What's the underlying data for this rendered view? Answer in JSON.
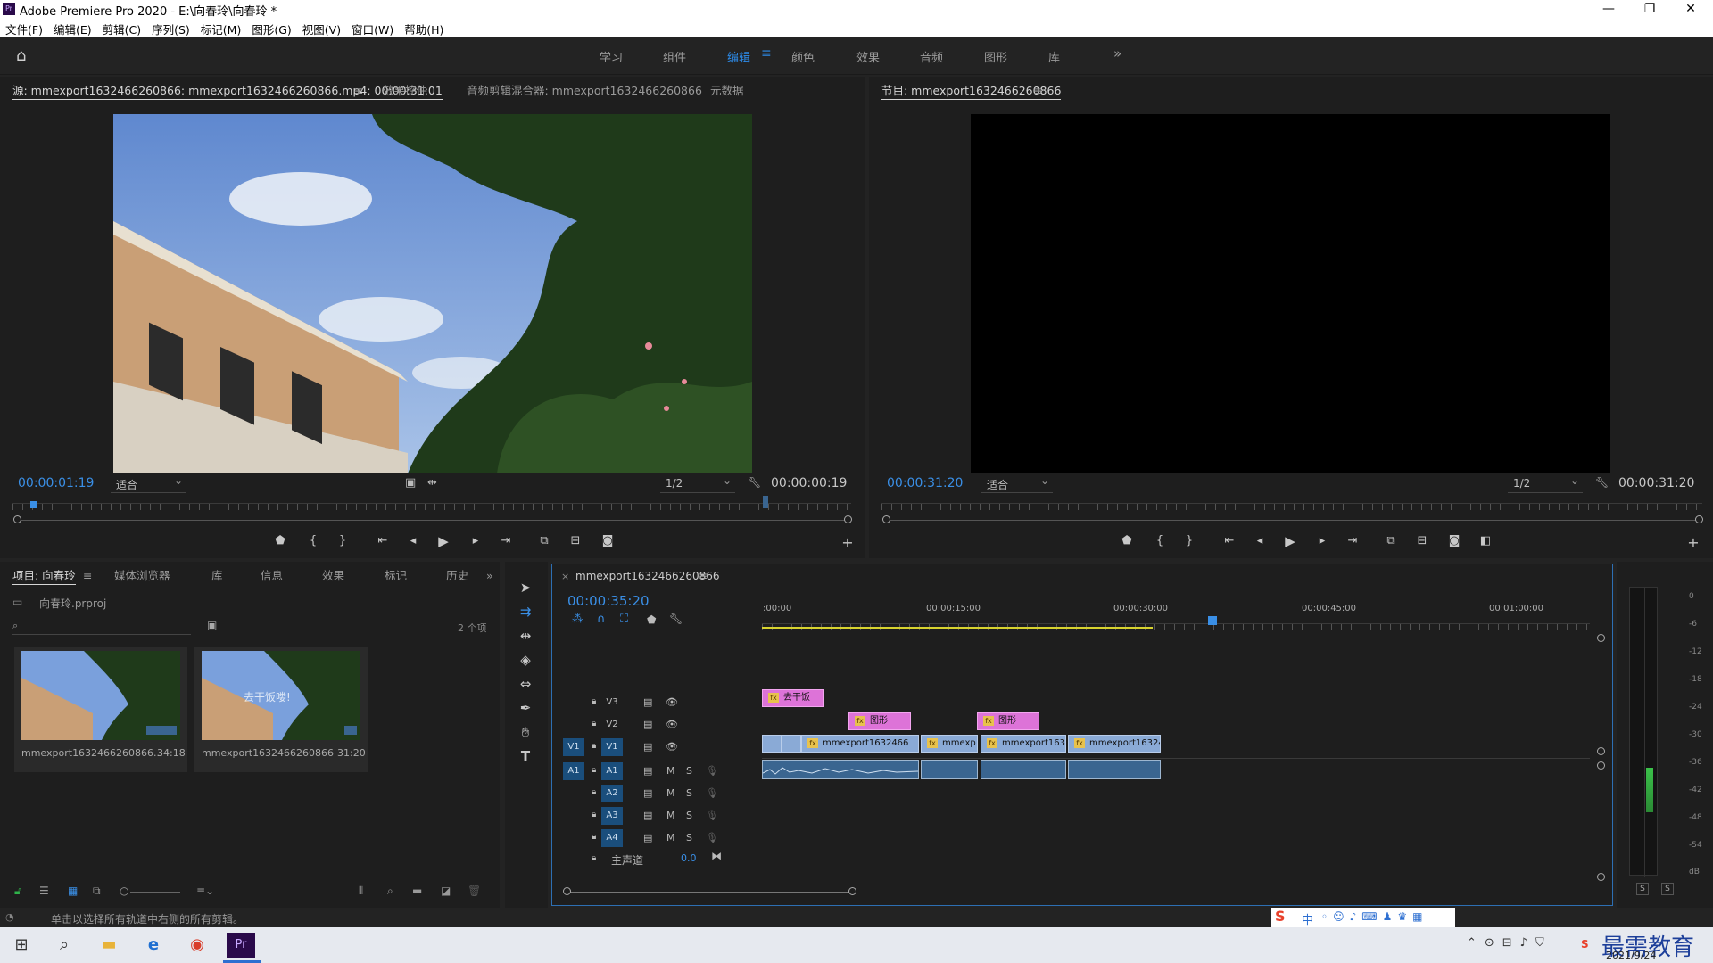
{
  "window": {
    "title": "Adobe Premiere Pro 2020 - E:\\向春玲\\向春玲 *",
    "app_icon_label": "Pr"
  },
  "menu": [
    "文件(F)",
    "编辑(E)",
    "剪辑(C)",
    "序列(S)",
    "标记(M)",
    "图形(G)",
    "视图(V)",
    "窗口(W)",
    "帮助(H)"
  ],
  "workspaces": [
    "学习",
    "组件",
    "编辑",
    "颜色",
    "效果",
    "音频",
    "图形",
    "库"
  ],
  "workspace_active": "编辑",
  "source_panel": {
    "tabs": [
      "源: mmexport1632466260866: mmexport1632466260866.mp4: 00:00:31:01",
      "效果控件",
      "音频剪辑混合器: mmexport1632466260866",
      "元数据"
    ],
    "timecode_in": "00:00:01:19",
    "fit": "适合",
    "resolution": "1/2",
    "duration": "00:00:00:19"
  },
  "program_panel": {
    "tab": "节目: mmexport1632466260866",
    "timecode_in": "00:00:31:20",
    "fit": "适合",
    "resolution": "1/2",
    "duration": "00:00:31:20"
  },
  "project_panel": {
    "tabs": [
      "项目: 向春玲",
      "媒体浏览器",
      "库",
      "信息",
      "效果",
      "标记",
      "历史"
    ],
    "project_file": "向春玲.prproj",
    "item_count": "2 个项",
    "items": [
      {
        "name": "mmexport1632466260866...",
        "duration": "34:18"
      },
      {
        "name": "mmexport1632466260866",
        "duration": "31:20",
        "overlay_text": "去干饭喽!"
      }
    ]
  },
  "timeline": {
    "tab": "mmexport1632466260866",
    "timecode": "00:00:35:20",
    "ruler_labels": [
      ":00:00",
      "00:00:15:00",
      "00:00:30:00",
      "00:00:45:00",
      "00:01:00:00"
    ],
    "video_tracks": [
      "V3",
      "V2",
      "V1"
    ],
    "audio_tracks": [
      "A1",
      "A2",
      "A3",
      "A4"
    ],
    "master_label": "主声道",
    "master_value": "0.0",
    "mute_label": "M",
    "solo_label": "S",
    "clips": {
      "v3": [
        {
          "label": "去干饭"
        }
      ],
      "v2": [
        {
          "label": "图形"
        },
        {
          "label": "图形"
        }
      ],
      "v1": [
        {
          "label": "mmexport1632466"
        },
        {
          "label": "mmexp"
        },
        {
          "label": "mmexport1632"
        },
        {
          "label": "mmexport163246"
        }
      ]
    }
  },
  "audio_meter": {
    "scale": [
      "0",
      "-6",
      "-12",
      "-18",
      "-24",
      "-30",
      "-36",
      "-42",
      "-48",
      "-54",
      "dB"
    ],
    "solo_labels": [
      "S",
      "S"
    ]
  },
  "status_bar": {
    "text": "单击以选择所有轨道中右侧的所有剪辑。"
  },
  "ime_bar": {
    "lang": "中"
  },
  "taskbar": {
    "date": "2021/9/24",
    "watermark": "最需教育"
  },
  "colors": {
    "accent": "#2d8ceb",
    "pink_clip": "#dd73d8",
    "blue_clip": "#8aaad6",
    "audio_clip": "#3a6590",
    "work_area": "#d8d32f"
  }
}
